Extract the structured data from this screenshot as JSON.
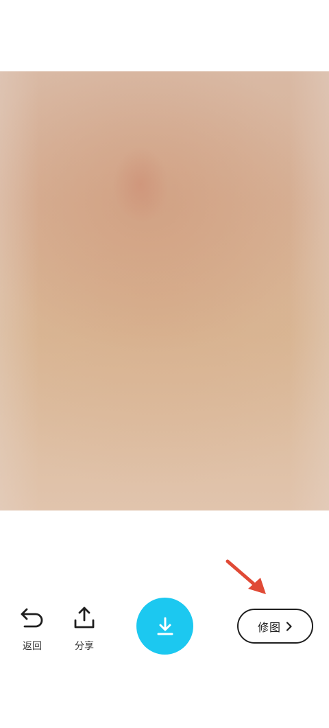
{
  "toolbar": {
    "back_label": "返回",
    "share_label": "分享",
    "edit_label": "修图"
  },
  "colors": {
    "download_button": "#1cc8f0",
    "annotation_arrow": "#e04a36"
  },
  "icons": {
    "back": "undo-arrow-icon",
    "share": "share-upload-icon",
    "download": "download-icon",
    "edit_chevron": "chevron-right-icon",
    "annotation": "red-pointer-arrow"
  }
}
